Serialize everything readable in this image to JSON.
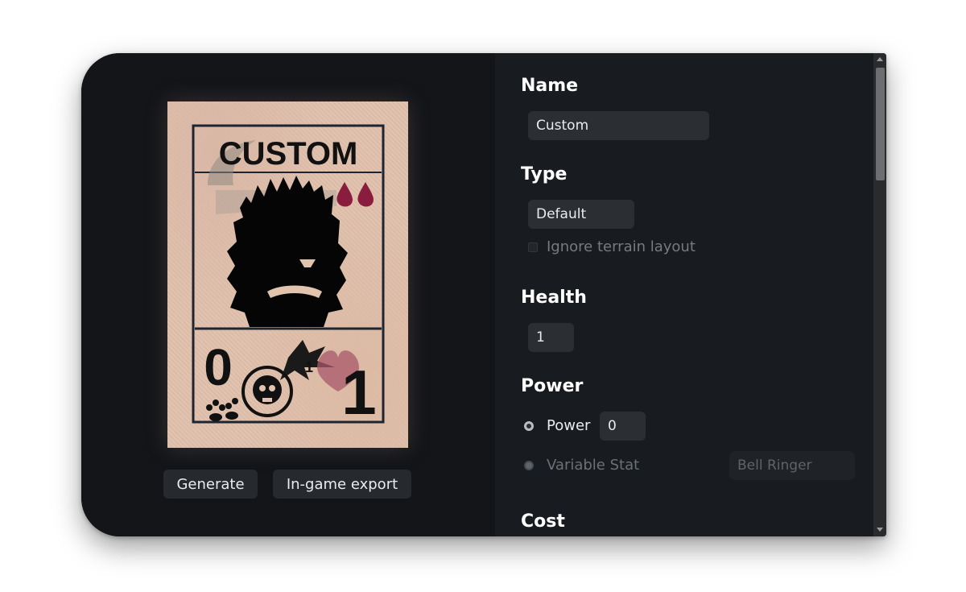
{
  "card": {
    "title": "CUSTOM",
    "attack": "0",
    "health": "1",
    "badge_number": "1",
    "blood_drops": 2
  },
  "actions": {
    "generate_label": "Generate",
    "export_label": "In-game export"
  },
  "form": {
    "name": {
      "label": "Name",
      "value": "Custom"
    },
    "type": {
      "label": "Type",
      "value": "Default",
      "ignore_terrain_label": "Ignore terrain layout"
    },
    "health": {
      "label": "Health",
      "value": "1"
    },
    "power": {
      "label": "Power",
      "option_power_label": "Power",
      "power_value": "0",
      "option_variable_label": "Variable Stat",
      "variable_placeholder": "Bell Ringer"
    },
    "cost": {
      "label": "Cost"
    }
  },
  "colors": {
    "window_bg": "#131519",
    "panel_bg": "#181b1f",
    "field_bg": "#2b2e33",
    "card_parchment": "#e2c4ae",
    "blood": "#8a1c3e",
    "heart": "#a8576a"
  }
}
